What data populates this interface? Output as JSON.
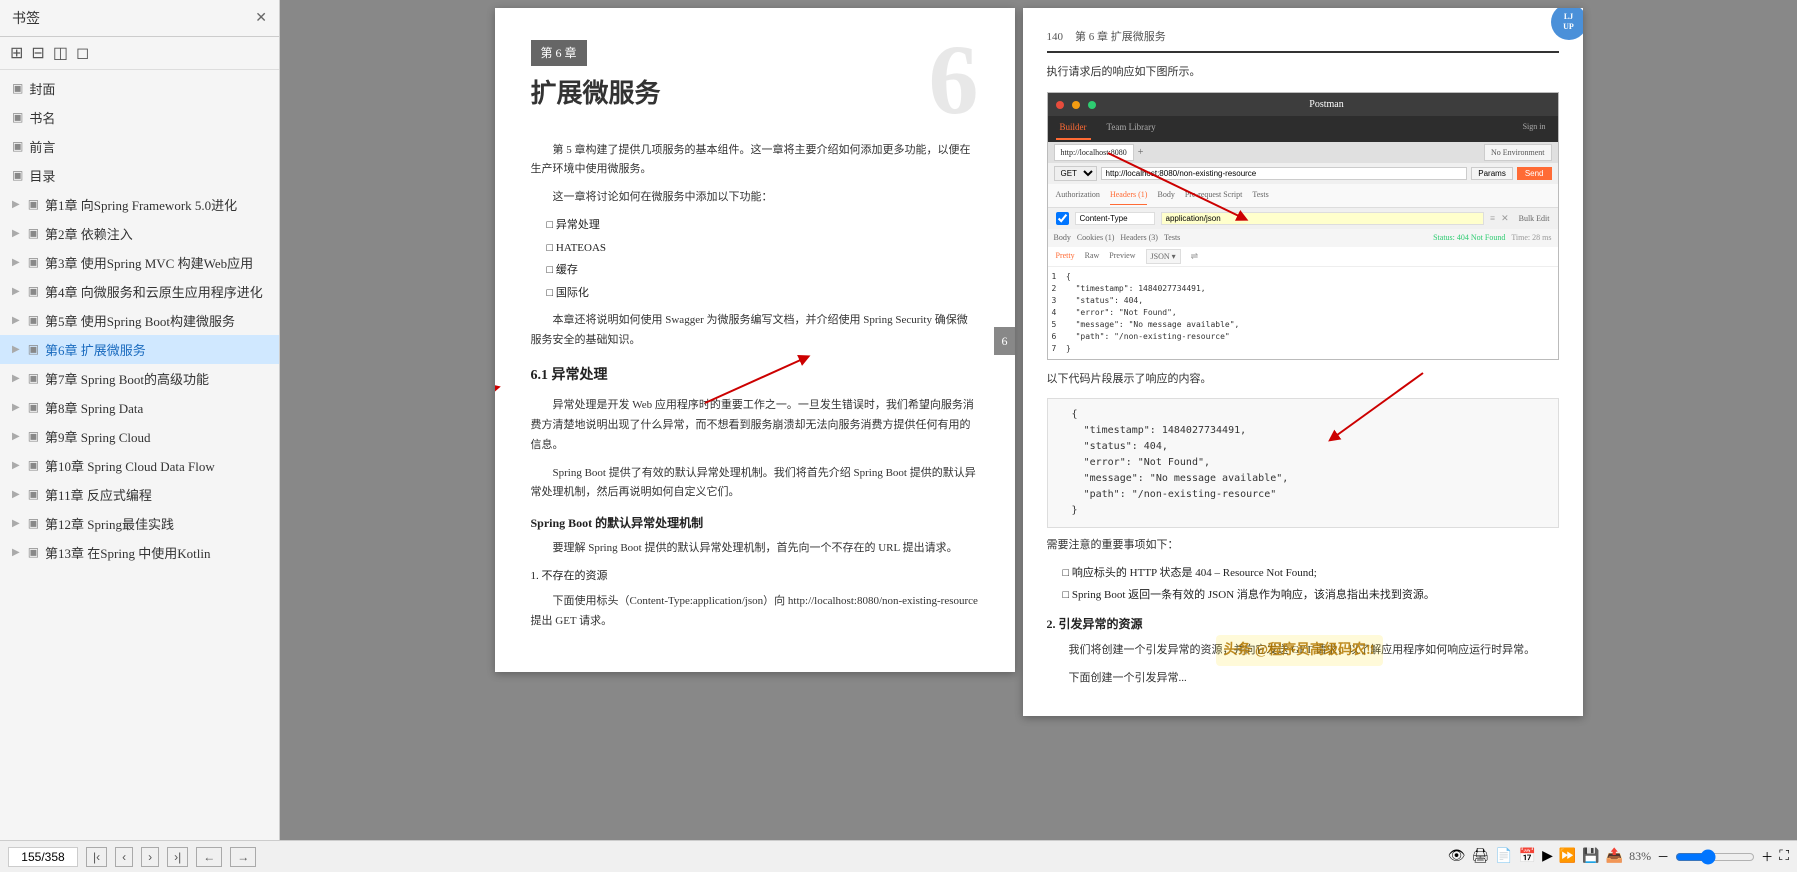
{
  "sidebar": {
    "title": "书签",
    "toolbar_icons": [
      "⊞",
      "⊟",
      "◫",
      "◻"
    ],
    "items": [
      {
        "id": "cover",
        "label": "封面",
        "indent": 0,
        "active": false
      },
      {
        "id": "bookname",
        "label": "书名",
        "indent": 0,
        "active": false
      },
      {
        "id": "preface",
        "label": "前言",
        "indent": 0,
        "active": false
      },
      {
        "id": "toc",
        "label": "目录",
        "indent": 0,
        "active": false
      },
      {
        "id": "ch1",
        "label": "第1章 向Spring Framework 5.0进化",
        "indent": 0,
        "active": false
      },
      {
        "id": "ch2",
        "label": "第2章 依赖注入",
        "indent": 0,
        "active": false
      },
      {
        "id": "ch3",
        "label": "第3章 使用Spring MVC 构建Web应用",
        "indent": 0,
        "active": false
      },
      {
        "id": "ch4",
        "label": "第4章 向微服务和云原生应用程序进化",
        "indent": 0,
        "active": false
      },
      {
        "id": "ch5",
        "label": "第5章 使用Spring Boot构建微服务",
        "indent": 0,
        "active": false
      },
      {
        "id": "ch6",
        "label": "第6章 扩展微服务",
        "indent": 0,
        "active": true
      },
      {
        "id": "ch7",
        "label": "第7章 Spring Boot的高级功能",
        "indent": 0,
        "active": false
      },
      {
        "id": "ch8",
        "label": "第8章 Spring Data",
        "indent": 0,
        "active": false
      },
      {
        "id": "ch9",
        "label": "第9章 Spring Cloud",
        "indent": 0,
        "active": false
      },
      {
        "id": "ch10",
        "label": "第10章 Spring Cloud Data Flow",
        "indent": 0,
        "active": false
      },
      {
        "id": "ch11",
        "label": "第11章 反应式编程",
        "indent": 0,
        "active": false
      },
      {
        "id": "ch12",
        "label": "第12章 Spring最佳实践",
        "indent": 0,
        "active": false
      },
      {
        "id": "ch13",
        "label": "第13章 在Spring 中使用Kotlin",
        "indent": 0,
        "active": false
      }
    ]
  },
  "left_page": {
    "chapter_label": "第 6 章",
    "chapter_title": "扩展微服务",
    "chapter_number": "6",
    "intro_text": "第 5 章构建了提供几项服务的基本组件。这一章将主要介绍如何添加更多功能，以便在生产环境中使用微服务。",
    "features_intro": "这一章将讨论如何在微服务中添加以下功能：",
    "features": [
      "异常处理",
      "HATEOAS",
      "缓存",
      "国际化"
    ],
    "swagger_text": "本章还将说明如何使用 Swagger 为微服务编写文档，并介绍使用 Spring Security 确保微服务安全的基础知识。",
    "section_61": "6.1  异常处理",
    "section_61_text1": "异常处理是开发 Web 应用程序时的重要工作之一。一旦发生错误时，我们希望向服务消费方清楚地说明出现了什么异常，而不想看到服务崩溃却无法向服务消费方提供任何有用的信息。",
    "section_61_text2": "Spring Boot 提供了有效的默认异常处理机制。我们将首先介绍 Spring Boot 提供的默认异常处理机制，然后再说明如何自定义它们。",
    "section_default": "Spring Boot 的默认异常处理机制",
    "section_default_text": "要理解 Spring Boot 提供的默认异常处理机制，首先向一个不存在的 URL 提出请求。",
    "subsection_1": "1. 不存在的资源",
    "subsection_1_text": "下面使用标头（Content-Type:application/json）向 http://localhost:8080/non-existing-resource 提出 GET 请求。"
  },
  "right_page": {
    "page_num": "140",
    "chapter_ref": "第 6 章  扩展微服务",
    "intro": "执行请求后的响应如下图所示。",
    "postman": {
      "title": "Postman",
      "tab_builder": "Builder",
      "tab_team": "Team Library",
      "sign_in": "Sign in",
      "no_env": "No Environment",
      "url": "http://localhost:8080",
      "method": "GET",
      "full_url": "http://localhost:8080/non-existing-resource",
      "params_btn": "Params",
      "send_btn": "Send",
      "req_tabs": [
        "Authorization",
        "Headers (1)",
        "Body",
        "Pre-request Script",
        "Tests"
      ],
      "header_key": "Content-Type",
      "header_value": "application/json",
      "body_tabs": [
        "Pretty",
        "Raw",
        "Preview"
      ],
      "body_format": "JSON",
      "status": "Status: 404 Not Found",
      "time": "Time: 28 ms",
      "response_code": "1 - {\n2   \"timestamp\": 1484027734491,\n3   \"status\": 404,\n4   \"error\": \"Not Found\",\n5   \"message\": \"No message available\",\n6   \"path\": \"/non-existing-resource\"\n7 }"
    },
    "code_caption": "以下代码片段展示了响应的内容。",
    "code_block": "{\n  \"timestamp\": 1484027734491,\n  \"status\": 404,\n  \"error\": \"Not Found\",\n  \"message\": \"No message available\",\n  \"path\": \"/non-existing-resource\"\n}",
    "notes_title": "需要注意的重要事项如下：",
    "notes": [
      "响应标头的 HTTP 状态是 404 – Resource Not Found;",
      "Spring Boot 返回一条有效的 JSON 消息作为响应，该消息指出未找到资源。"
    ],
    "section_2": "2. 引发异常的资源",
    "section_2_text": "我们将创建一个引发异常的资源，并向它发送 GET 请求，以了解应用程序如何响应运行时异常。",
    "section_2_text2": "下面创建一个引发异常..."
  },
  "bottom_bar": {
    "page_display": "155/358",
    "nav_prev": "‹",
    "nav_next": "›",
    "nav_first": "|‹",
    "nav_last": "›|",
    "back": "←",
    "forward": "→"
  },
  "watermark": "头条 @程序员高级码农‼",
  "page_badge": "6",
  "colors": {
    "accent": "#4a90d9",
    "active_item": "#d0e8ff",
    "red_arrow": "#cc0000",
    "chapter_gray": "#e0e0e0"
  }
}
